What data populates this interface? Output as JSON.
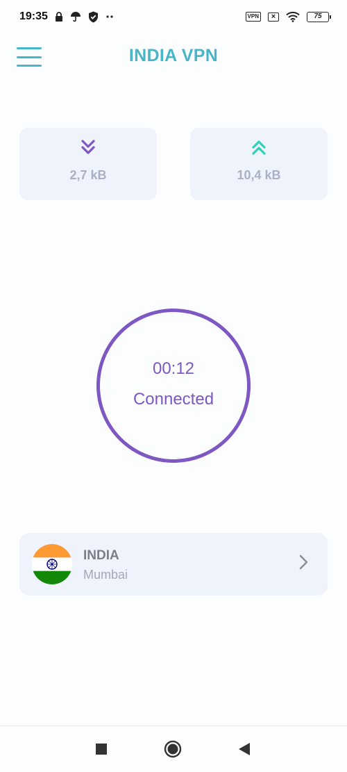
{
  "status_bar": {
    "time": "19:35",
    "left_icons": [
      "lock-icon",
      "umbrella-icon",
      "shield-check-icon",
      "more-dots-icon"
    ],
    "vpn_label": "VPN",
    "battery_level": "75",
    "right_icons": [
      "vpn-icon",
      "no-sim-icon",
      "wifi-icon",
      "battery-icon"
    ]
  },
  "app_bar": {
    "title": "INDIA VPN",
    "menu_icon": "hamburger-menu-icon"
  },
  "stats": {
    "download": {
      "value": "2,7 kB",
      "icon": "double-chevron-down-icon",
      "color": "#7E57C2"
    },
    "upload": {
      "value": "10,4 kB",
      "icon": "double-chevron-up-icon",
      "color": "#2ED3B7"
    }
  },
  "connection": {
    "timer": "00:12",
    "status": "Connected",
    "ring_color": "#7E57C2"
  },
  "server": {
    "country": "INDIA",
    "city": "Mumbai",
    "flag_icon": "india-flag-icon",
    "chevron_icon": "chevron-right-icon"
  },
  "nav_bar": {
    "buttons": [
      "recents-square-icon",
      "home-circle-icon",
      "back-triangle-icon"
    ]
  },
  "colors": {
    "accent_teal": "#47B6C9",
    "accent_purple": "#7E57C2",
    "card_bg": "#EEF3FC"
  }
}
